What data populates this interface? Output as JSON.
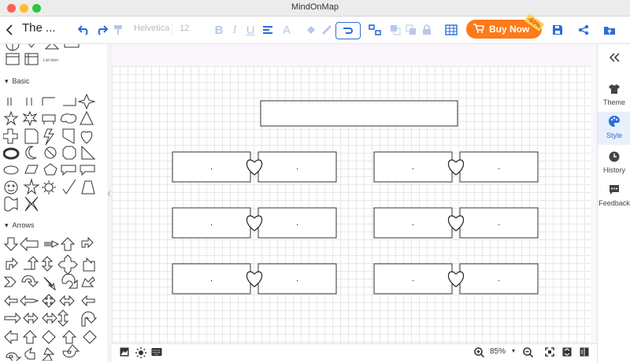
{
  "app": {
    "window_title": "MindOnMap",
    "doc_title": "The ..."
  },
  "toolbar": {
    "font_name": "Helvetica",
    "font_size": "12",
    "buy_label": "Buy Now",
    "discount_badge": "-60%"
  },
  "left_panel": {
    "list_item_caption": "List Item",
    "sections": [
      "Basic",
      "Arrows"
    ]
  },
  "right_panel": {
    "items": [
      "Theme",
      "Style",
      "History",
      "Feedback"
    ],
    "active": "Style"
  },
  "status_bar": {
    "zoom": "85%"
  },
  "diagram": {
    "top_box_text": "",
    "box_text": ".",
    "pairs": 6
  },
  "colors": {
    "accent": "#2b6cd9",
    "buy_now": "#ff7a1a",
    "active_tab_bg": "#e8f0fb"
  }
}
